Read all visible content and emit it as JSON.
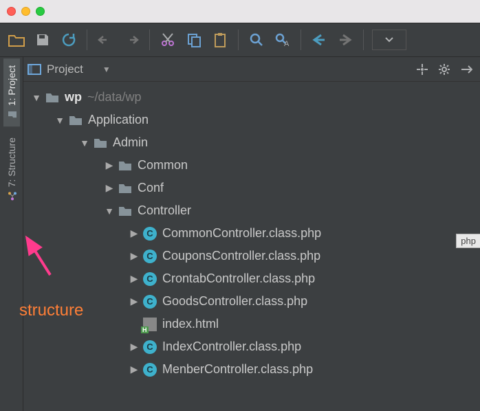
{
  "window": {
    "os": "mac"
  },
  "toolbar": {
    "buttons": [
      "open",
      "save",
      "sync",
      "sep",
      "undo",
      "redo",
      "sep",
      "cut",
      "copy",
      "paste",
      "sep",
      "find",
      "find-replace",
      "sep",
      "back",
      "forward",
      "sep",
      "run-config"
    ]
  },
  "left_tabs": {
    "project": {
      "label": "1: Project"
    },
    "structure": {
      "label": "7: Structure"
    }
  },
  "panel": {
    "title": "Project"
  },
  "tree": {
    "root": {
      "name": "wp",
      "hint": "~/data/wp"
    },
    "application": "Application",
    "admin": "Admin",
    "common": "Common",
    "conf": "Conf",
    "controller": "Controller",
    "files": [
      "CommonController.class.php",
      "CouponsController.class.php",
      "CrontabController.class.php",
      "GoodsController.class.php",
      "index.html",
      "IndexController.class.php",
      "MenberController.class.php"
    ]
  },
  "annotation": {
    "text": "structure"
  },
  "right_edge_tab": "php"
}
